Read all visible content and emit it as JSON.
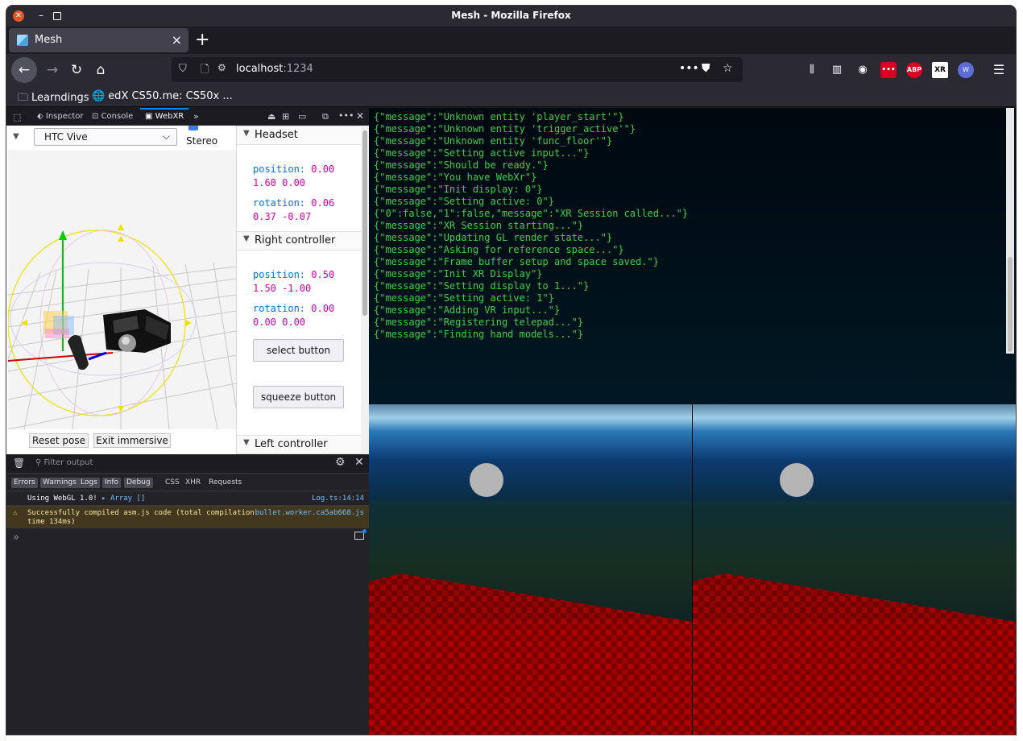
{
  "window": {
    "title": "Mesh - Mozilla Firefox"
  },
  "tab": {
    "label": "Mesh"
  },
  "url": {
    "host": "localhost",
    "port": ":1234"
  },
  "bookmarks": [
    {
      "label": "Learndings"
    },
    {
      "label": "edX CS50.me: CS50x ..."
    }
  ],
  "devtools": {
    "tabs": [
      "Inspector",
      "Console",
      "WebXR"
    ],
    "webxr": {
      "device": "HTC Vive",
      "stereo_label": "Stereo",
      "reset_pose": "Reset pose",
      "exit_immersive": "Exit immersive",
      "headset": {
        "title": "Headset",
        "position_label": "position:",
        "position_x": "0.00",
        "position_yz": "1.60 0.00",
        "rotation_label": "rotation:",
        "rotation_x": "0.06",
        "rotation_yz": "0.37 -0.07"
      },
      "right_controller": {
        "title": "Right controller",
        "position_label": "position:",
        "position_x": "0.50",
        "position_yz": "1.50 -1.00",
        "rotation_label": "rotation:",
        "rotation_x": "0.00",
        "rotation_yz": "0.00 0.00",
        "select_button": "select button",
        "squeeze_button": "squeeze button"
      },
      "left_controller": {
        "title": "Left controller"
      }
    },
    "console": {
      "filter_placeholder": "Filter output",
      "filters": [
        "Errors",
        "Warnings",
        "Logs",
        "Info",
        "Debug"
      ],
      "net_filters": [
        "CSS",
        "XHR",
        "Requests"
      ],
      "messages": [
        {
          "text": "Using WebGL 1.0!",
          "array": "Array []",
          "source": "Log.ts:14:14",
          "level": "log"
        },
        {
          "text": "Successfully compiled asm.js code (total compilation",
          "text2": "time 134ms)",
          "source": "bullet.worker.ca5ab668.js",
          "level": "warning"
        }
      ],
      "prompt": "»"
    }
  },
  "page": {
    "log_lines": [
      "{\"message\":\"Unknown entity 'player_start'\"}",
      "{\"message\":\"Unknown entity 'trigger_active'\"}",
      "{\"message\":\"Unknown entity 'func_floor'\"}",
      "{\"message\":\"Setting active input...\"}",
      "{\"message\":\"Should be ready.\"}",
      "{\"message\":\"You have WebXr\"}",
      "{\"message\":\"Init display: 0\"}",
      "{\"message\":\"Setting active: 0\"}",
      "{\"0\":false,\"1\":false,\"message\":\"XR Session called...\"}",
      "{\"message\":\"XR Session starting...\"}",
      "{\"message\":\"Updating GL render state...\"}",
      "{\"message\":\"Asking for reference space...\"}",
      "{\"message\":\"Frame buffer setup and space saved.\"}",
      "{\"message\":\"Init XR Display\"}",
      "{\"message\":\"Setting display to 1...\"}",
      "{\"message\":\"Setting active: 1\"}",
      "{\"message\":\"Adding VR input...\"}",
      "{\"message\":\"Registering telepad...\"}",
      "{\"message\":\"Finding hand models...\"}"
    ]
  },
  "colors": {
    "accent": "#0a84ff",
    "log_text": "#3bd04a",
    "floor_red": "#8b0000",
    "close_orange": "#e95420"
  }
}
